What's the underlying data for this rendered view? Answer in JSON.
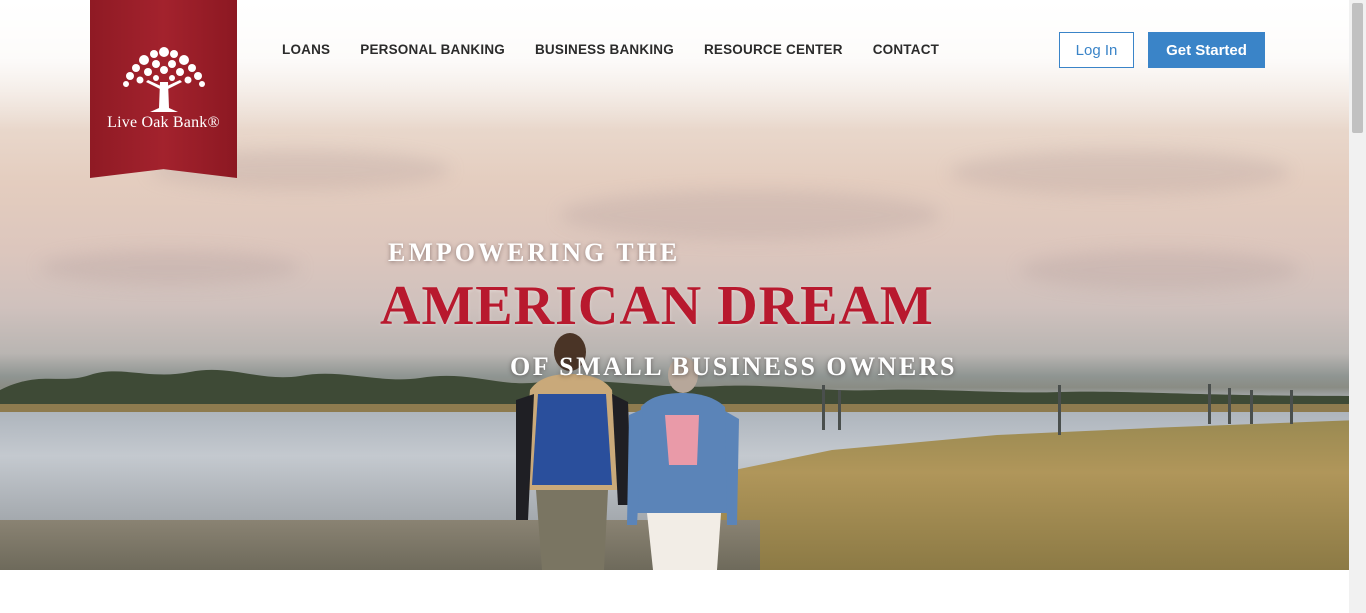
{
  "brand": {
    "name": "LIVE OAK BANK",
    "name_display": "Live Oak Bank®",
    "color": "#a3222d"
  },
  "nav": {
    "items": [
      {
        "label": "LOANS"
      },
      {
        "label": "PERSONAL BANKING"
      },
      {
        "label": "BUSINESS BANKING"
      },
      {
        "label": "RESOURCE CENTER"
      },
      {
        "label": "CONTACT"
      }
    ]
  },
  "actions": {
    "login_label": "Log In",
    "get_started_label": "Get Started",
    "accent": "#3a84c8"
  },
  "hero": {
    "line1": "EMPOWERING THE",
    "line2": "AMERICAN DREAM",
    "line3": "OF SMALL BUSINESS OWNERS",
    "headline_color": "#b8192e"
  }
}
